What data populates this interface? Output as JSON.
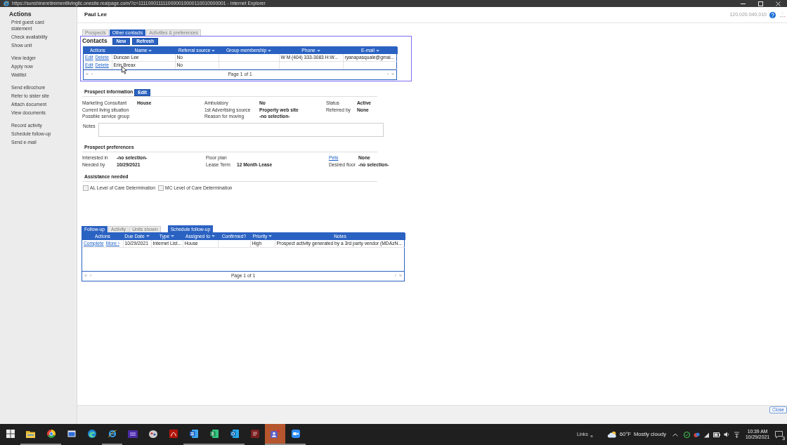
{
  "browser": {
    "title": "https://sunshineretirementlivingllc.onesite.realpage.com/?c=1111000111110000010000110010000001 - Internet Explorer"
  },
  "sidebar": {
    "title": "Actions",
    "groups": [
      {
        "items": [
          "Print guest card statement",
          "Check availability",
          "Show unit"
        ]
      },
      {
        "items": [
          "View ledger",
          "Apply now",
          "Waitlist"
        ]
      },
      {
        "items": [
          "Send eBrochure",
          "Refer to sister site",
          "Attach document",
          "View documents"
        ]
      },
      {
        "items": [
          "Record activity",
          "Schedule follow-up",
          "Send e-mail"
        ]
      }
    ]
  },
  "header": {
    "title": "Paul Lee",
    "version": "120.020.040.010"
  },
  "prospect_tabs": [
    {
      "label": "Prospects",
      "selected": false
    },
    {
      "label": "Other contacts",
      "selected": true
    },
    {
      "label": "Activities & preferences",
      "selected": false
    }
  ],
  "contacts": {
    "title": "Contacts",
    "buttons": [
      "New",
      "Refresh"
    ],
    "columns": [
      {
        "label": "Actions",
        "sortable": false
      },
      {
        "label": "Name",
        "sortable": true
      },
      {
        "label": "Referral source",
        "sortable": true
      },
      {
        "label": "Group membership",
        "sortable": true
      },
      {
        "label": "Phone",
        "sortable": true
      },
      {
        "label": "E-mail",
        "sortable": true
      }
    ],
    "rows": [
      {
        "cells": [
          [
            "Edit",
            "Delete"
          ],
          "Duncan Lee",
          "No",
          "",
          "W M (404) 333-3083 H:W...",
          "ryanapasquale@gmai..."
        ]
      },
      {
        "cells": [
          [
            "Edit",
            "Delete"
          ],
          "Erin Breax",
          "No",
          "",
          "",
          ""
        ]
      }
    ],
    "pager": {
      "first": "«",
      "previous": "‹",
      "label": "Page 1 of 1",
      "next": "›",
      "last": "»"
    }
  },
  "prospect_information": {
    "title": "Prospect information",
    "edit_button": "Edit",
    "columns": [
      {
        "fields": [
          {
            "label": "Marketing Consultant",
            "value": "House"
          },
          {
            "label": "Current living situation"
          },
          {
            "label": "Possible service group"
          }
        ]
      },
      {
        "fields": [
          {
            "label": "Ambulatory",
            "value": "No"
          },
          {
            "label": "1st Advertising source",
            "value": "Property web site"
          },
          {
            "label": "Reason for moving",
            "value": "-no selection-"
          }
        ]
      },
      {
        "fields": [
          {
            "label": "Status",
            "value": "Active"
          },
          {
            "label": "Referred by",
            "value": "None"
          }
        ]
      }
    ],
    "notes_label": "Notes"
  },
  "prospect_preferences": {
    "title": "Prospect preferences",
    "columns": [
      {
        "fields": [
          {
            "label": "Interested in",
            "value": "-no selection-",
            "kind": "text"
          },
          {
            "label": "Needed by",
            "value": "10/29/2021",
            "kind": "text"
          }
        ]
      },
      {
        "fields": [
          {
            "label": "Floor plan",
            "kind": "text"
          },
          {
            "label": "Lease Term",
            "value": "12 Month Lease",
            "kind": "text"
          }
        ]
      },
      {
        "fields": [
          {
            "label": "Pets",
            "value": "None",
            "kind": "link"
          },
          {
            "label": "Desired floor",
            "value": "-no selection-",
            "kind": "text"
          }
        ]
      }
    ]
  },
  "assistance": {
    "title": "Assistance needed",
    "options": [
      {
        "label": "AL Level of Care Determination",
        "checked": false
      },
      {
        "label": "MC Level of Care Determination",
        "checked": false
      }
    ]
  },
  "follow_up": {
    "tabs": [
      {
        "label": "Follow-up",
        "selected": true
      },
      {
        "label": "Activity",
        "selected": false
      },
      {
        "label": "Units shown",
        "selected": false
      }
    ],
    "schedule_button": "Schedule follow-up",
    "columns": [
      {
        "label": "Actions",
        "sortable": false
      },
      {
        "label": "Due Date",
        "sortable": true
      },
      {
        "label": "Type",
        "sortable": true
      },
      {
        "label": "Assigned to",
        "sortable": true
      },
      {
        "label": "Confirmed?",
        "sortable": false
      },
      {
        "label": "Priority",
        "sortable": true
      },
      {
        "label": "Notes",
        "sortable": false
      }
    ],
    "rows": [
      {
        "cells": [
          [
            "Complete",
            "More ›"
          ],
          "10/29/2021",
          "Internet List...",
          "House",
          "",
          "High",
          "Prospect activity generated by a 3rd party vendor (MDAzN..."
        ]
      }
    ],
    "pager": {
      "first": "«",
      "previous": "‹",
      "label": "Page 1 of 1",
      "next": "›",
      "last": "»"
    }
  },
  "footer": {
    "close_button": "Close"
  },
  "taskbar": {
    "apps": [
      {
        "kind": "start",
        "running": false,
        "highlighted": false
      },
      {
        "kind": "folder",
        "running": true,
        "highlighted": false
      },
      {
        "kind": "wheel",
        "running": true,
        "highlighted": false
      },
      {
        "kind": "window",
        "running": false,
        "highlighted": false
      },
      {
        "kind": "swirl",
        "running": false,
        "highlighted": false
      },
      {
        "kind": "ring",
        "running": true,
        "highlighted": false
      },
      {
        "kind": "panel",
        "running": false,
        "highlighted": false
      },
      {
        "kind": "palette",
        "running": false,
        "highlighted": false
      },
      {
        "kind": "pdf",
        "running": false,
        "highlighted": false
      },
      {
        "kind": "doc",
        "running": true,
        "highlighted": false
      },
      {
        "kind": "sheet",
        "running": true,
        "highlighted": false
      },
      {
        "kind": "mail",
        "running": true,
        "highlighted": false
      },
      {
        "kind": "tile",
        "running": false,
        "highlighted": false
      },
      {
        "kind": "people",
        "running": true,
        "highlighted": true
      },
      {
        "kind": "camera",
        "running": true,
        "highlighted": false
      }
    ],
    "links": {
      "label": "Links",
      "more": "»"
    },
    "weather": {
      "temperature": "60°F",
      "condition": "Mostly cloudy"
    },
    "clock": {
      "time": "10:39 AM",
      "date": "10/29/2021"
    },
    "notifications": "3"
  }
}
